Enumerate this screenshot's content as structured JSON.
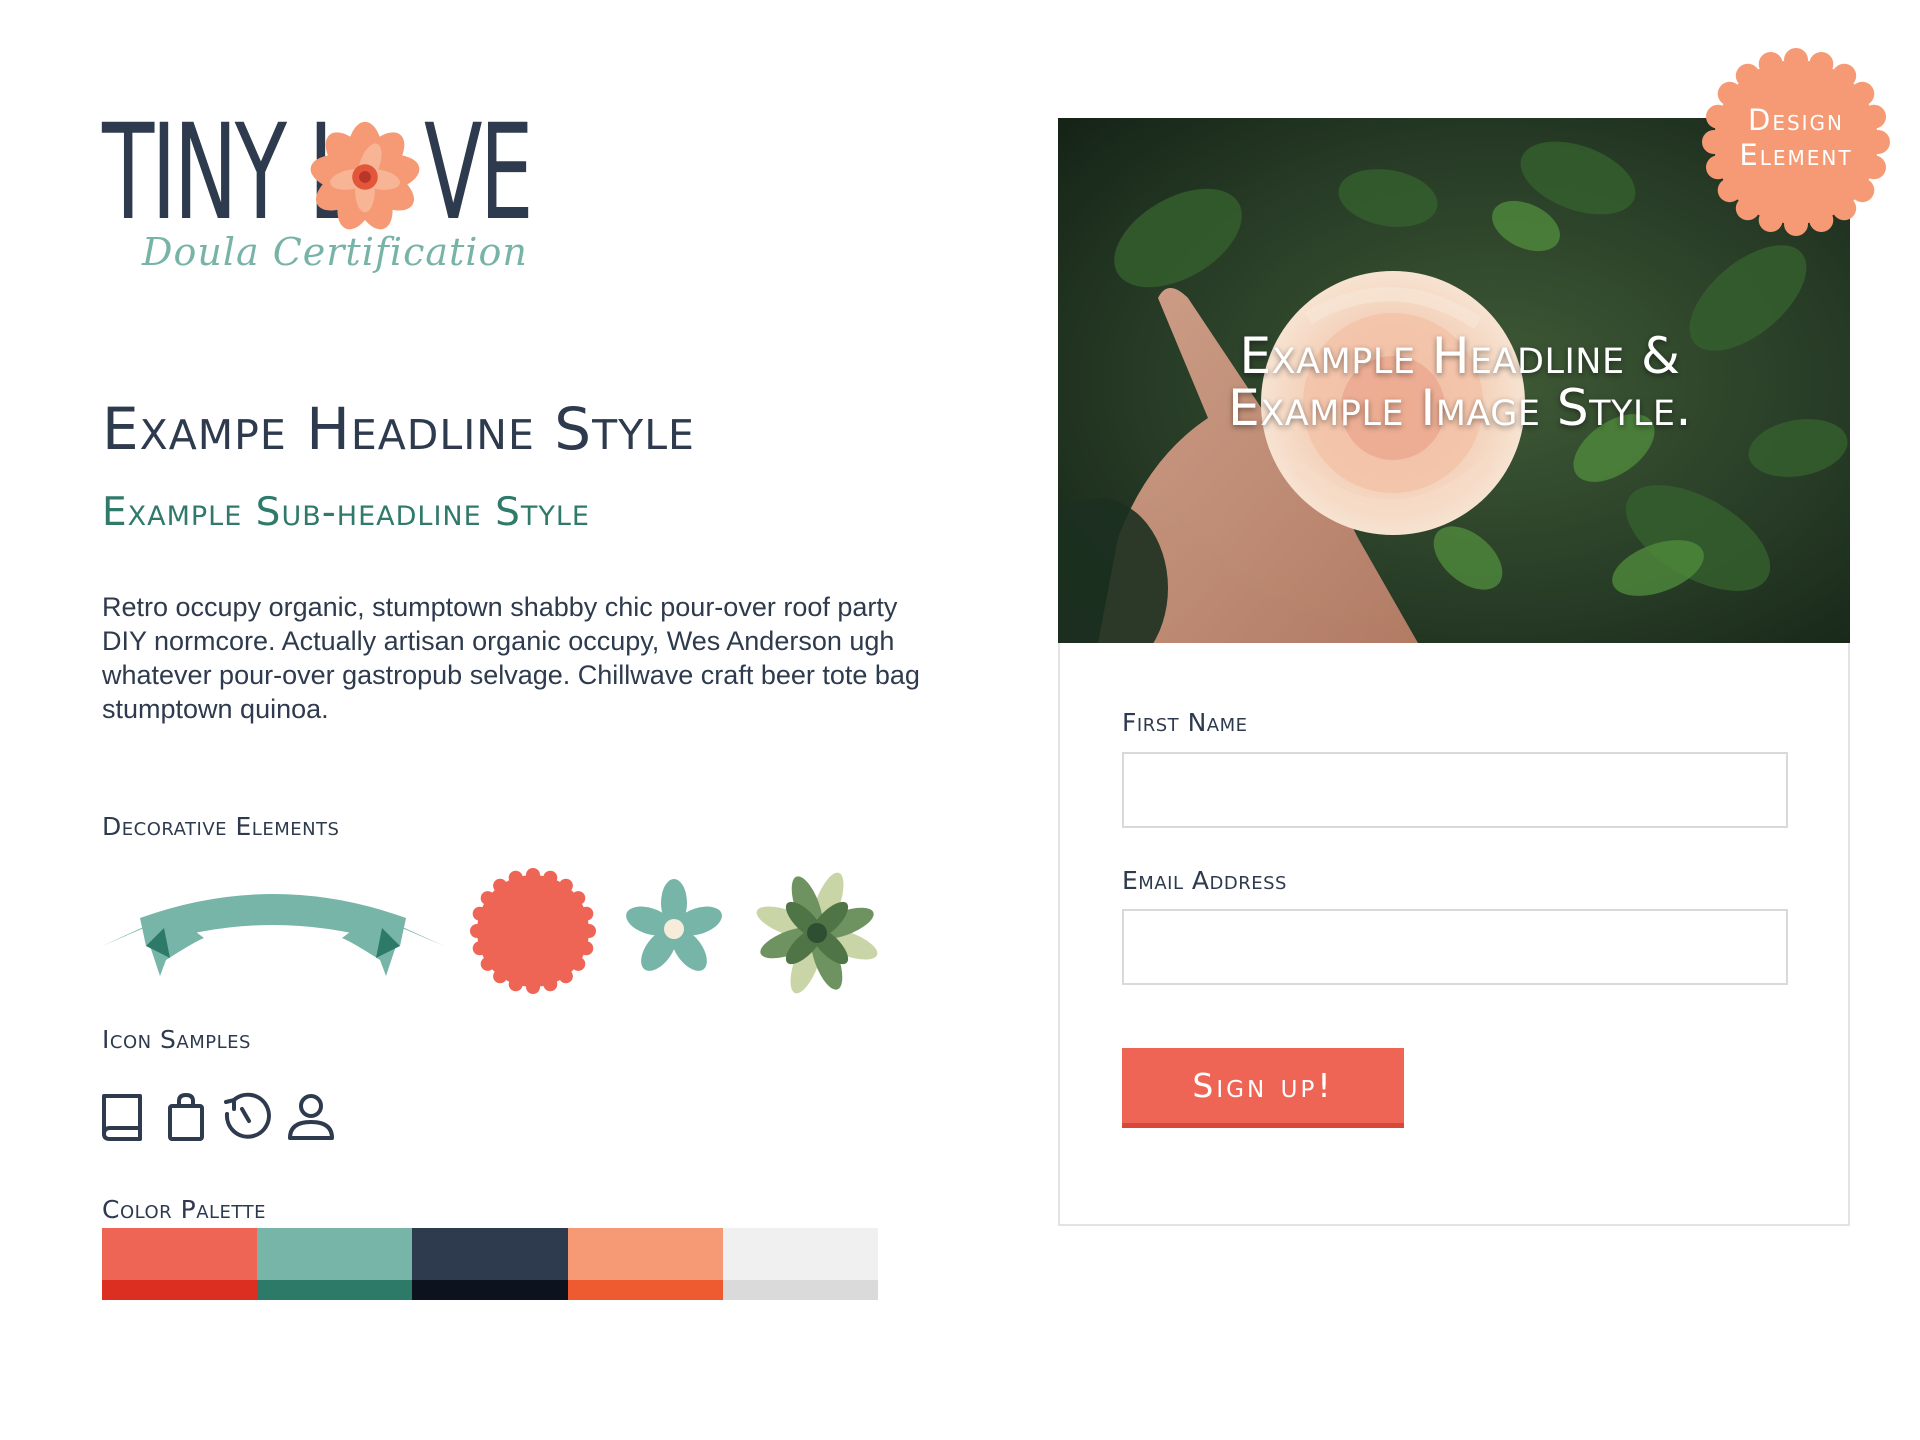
{
  "logo": {
    "word_left": "TINY L",
    "word_right": "VE",
    "tagline": "Doula Certification"
  },
  "typography": {
    "headline": "Exampe Headline Style",
    "subheadline": "Example Sub-headline Style",
    "body": "Retro occupy organic, stumptown shabby chic pour-over roof party DIY normcore. Actually artisan organic occupy, Wes Anderson ugh whatever pour-over gastropub selvage. Chillwave craft beer tote bag stumptown quinoa."
  },
  "sections": {
    "decorative_label": "Decorative Elements",
    "icons_label": "Icon Samples",
    "palette_label": "Color Palette"
  },
  "decorative_items": [
    "ribbon-banner",
    "scalloped-circle",
    "small-flower",
    "succulent"
  ],
  "icons": [
    "book-icon",
    "shopping-bag-icon",
    "history-clock-icon",
    "user-icon"
  ],
  "palette": [
    {
      "main": "#ee6555",
      "shade": "#dc2f22"
    },
    {
      "main": "#77b5a9",
      "shade": "#2e7a68"
    },
    {
      "main": "#2e3a4d",
      "shade": "#0c121e"
    },
    {
      "main": "#f59a74",
      "shade": "#ee5b30"
    },
    {
      "main": "#f0f0f0",
      "shade": "#dadada"
    }
  ],
  "hero": {
    "title": "Example Headline & Example Image Style."
  },
  "badge": {
    "line1": "Design",
    "line2": "Element"
  },
  "form": {
    "first_name_label": "First Name",
    "first_name_value": "",
    "email_label": "Email Address",
    "email_value": "",
    "submit_label": "Sign up!"
  }
}
